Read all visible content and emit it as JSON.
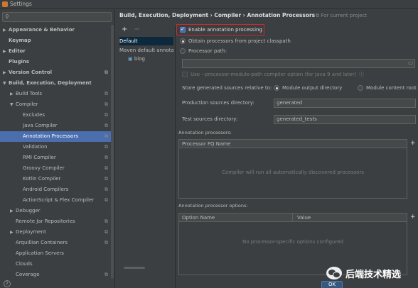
{
  "window": {
    "title": "Settings"
  },
  "search": {
    "icon": "search-icon",
    "value": ""
  },
  "tree": [
    {
      "label": "Appearance & Behavior",
      "bold": true,
      "arrow": "▶",
      "indent": 0,
      "project": false,
      "selected": false
    },
    {
      "label": "Keymap",
      "bold": true,
      "arrow": "",
      "indent": 0,
      "project": false,
      "selected": false
    },
    {
      "label": "Editor",
      "bold": true,
      "arrow": "▶",
      "indent": 0,
      "project": false,
      "selected": false
    },
    {
      "label": "Plugins",
      "bold": true,
      "arrow": "",
      "indent": 0,
      "project": false,
      "selected": false
    },
    {
      "label": "Version Control",
      "bold": true,
      "arrow": "▶",
      "indent": 0,
      "project": true,
      "selected": false
    },
    {
      "label": "Build, Execution, Deployment",
      "bold": true,
      "arrow": "▼",
      "indent": 0,
      "project": false,
      "selected": false
    },
    {
      "label": "Build Tools",
      "bold": false,
      "arrow": "▶",
      "indent": 1,
      "project": true,
      "selected": false
    },
    {
      "label": "Compiler",
      "bold": false,
      "arrow": "▼",
      "indent": 1,
      "project": true,
      "selected": false
    },
    {
      "label": "Excludes",
      "bold": false,
      "arrow": "",
      "indent": 2,
      "project": true,
      "selected": false
    },
    {
      "label": "Java Compiler",
      "bold": false,
      "arrow": "",
      "indent": 2,
      "project": true,
      "selected": false
    },
    {
      "label": "Annotation Processors",
      "bold": false,
      "arrow": "",
      "indent": 2,
      "project": true,
      "selected": true
    },
    {
      "label": "Validation",
      "bold": false,
      "arrow": "",
      "indent": 2,
      "project": true,
      "selected": false
    },
    {
      "label": "RMI Compiler",
      "bold": false,
      "arrow": "",
      "indent": 2,
      "project": true,
      "selected": false
    },
    {
      "label": "Groovy Compiler",
      "bold": false,
      "arrow": "",
      "indent": 2,
      "project": true,
      "selected": false
    },
    {
      "label": "Kotlin Compiler",
      "bold": false,
      "arrow": "",
      "indent": 2,
      "project": true,
      "selected": false
    },
    {
      "label": "Android Compilers",
      "bold": false,
      "arrow": "",
      "indent": 2,
      "project": true,
      "selected": false
    },
    {
      "label": "ActionScript & Flex Compiler",
      "bold": false,
      "arrow": "",
      "indent": 2,
      "project": true,
      "selected": false
    },
    {
      "label": "Debugger",
      "bold": false,
      "arrow": "▶",
      "indent": 1,
      "project": false,
      "selected": false
    },
    {
      "label": "Remote Jar Repositories",
      "bold": false,
      "arrow": "",
      "indent": 1,
      "project": true,
      "selected": false
    },
    {
      "label": "Deployment",
      "bold": false,
      "arrow": "▶",
      "indent": 1,
      "project": true,
      "selected": false
    },
    {
      "label": "Arquillian Containers",
      "bold": false,
      "arrow": "",
      "indent": 1,
      "project": true,
      "selected": false
    },
    {
      "label": "Application Servers",
      "bold": false,
      "arrow": "",
      "indent": 1,
      "project": false,
      "selected": false
    },
    {
      "label": "Clouds",
      "bold": false,
      "arrow": "",
      "indent": 1,
      "project": false,
      "selected": false
    },
    {
      "label": "Coverage",
      "bold": false,
      "arrow": "",
      "indent": 1,
      "project": true,
      "selected": false
    }
  ],
  "breadcrumb": "Build, Execution, Deployment  ›  Compiler  ›  Annotation Processors",
  "for_current_project": "For current project",
  "profiles": {
    "add": "+",
    "remove": "−",
    "items": [
      "Default",
      "Maven default annotation processors profile"
    ],
    "module": "blog"
  },
  "options": {
    "enable_label": "Enable annotation processing",
    "enable_checked": true,
    "obtain_label": "Obtain processors from project classpath",
    "processor_path_label": "Processor path:",
    "processor_path_value": "",
    "module_path_label": "Use --processor-module-path compiler option (for Java 9 and later)",
    "store_label": "Store generated sources relative to:",
    "module_output_label": "Module output directory",
    "module_content_label": "Module content root",
    "prod_label": "Production sources directory:",
    "prod_value": "generated",
    "test_label": "Test sources directory:",
    "test_value": "generated_tests"
  },
  "processors": {
    "section_label": "Annotation processors:",
    "column": "Processor FQ Name",
    "empty": "Compiler will run all automatically discovered processors"
  },
  "proc_options": {
    "section_label": "Annotation processor options:",
    "col_name": "Option Name",
    "col_value": "Value",
    "empty": "No processor-specific options configured"
  },
  "footer": {
    "ok": "OK",
    "help": "?"
  },
  "watermark": {
    "text": "后端技术精选"
  },
  "colors": {
    "selection": "#4b6eaf",
    "highlight": "#c92b2b",
    "background": "#3c3f41"
  }
}
